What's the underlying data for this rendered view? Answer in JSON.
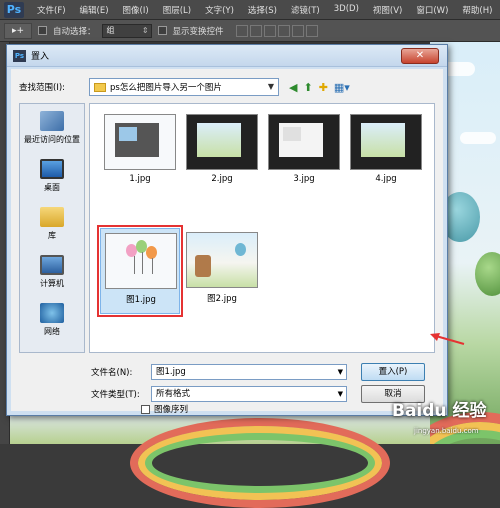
{
  "app": {
    "logo": "Ps",
    "menu": [
      "文件(F)",
      "编辑(E)",
      "图像(I)",
      "图层(L)",
      "文字(Y)",
      "选择(S)",
      "滤镜(T)",
      "3D(D)",
      "视图(V)",
      "窗口(W)",
      "帮助(H)"
    ]
  },
  "options_bar": {
    "auto_select_label": "自动选择：",
    "auto_select_value": "组",
    "show_transform_label": "显示变换控件"
  },
  "dialog": {
    "title": "置入",
    "close_icon": "close-icon",
    "look_in_label": "查找范围(I):",
    "look_in_value": "ps怎么把图片导入另一个图片",
    "places": [
      {
        "label": "最近访问的位置",
        "icon": "recent-places-icon"
      },
      {
        "label": "桌面",
        "icon": "desktop-icon"
      },
      {
        "label": "库",
        "icon": "library-icon"
      },
      {
        "label": "计算机",
        "icon": "computer-icon"
      },
      {
        "label": "网络",
        "icon": "network-icon"
      }
    ],
    "files": [
      {
        "name": "1.jpg"
      },
      {
        "name": "2.jpg"
      },
      {
        "name": "3.jpg"
      },
      {
        "name": "4.jpg"
      },
      {
        "name": "图1.jpg",
        "selected": true
      },
      {
        "name": "图2.jpg"
      }
    ],
    "filename_label": "文件名(N):",
    "filename_value": "图1.jpg",
    "filetype_label": "文件类型(T):",
    "filetype_value": "所有格式",
    "place_button": "置入(P)",
    "cancel_button": "取消",
    "image_sequence_label": "图像序列"
  },
  "watermark": {
    "text": "Baidu 经验",
    "sub": "jingyan.baidu.com"
  },
  "colors": {
    "selection_highlight": "#e53232",
    "dialog_bg": "#f0f0f0",
    "ps_chrome": "#4a4a4a"
  }
}
